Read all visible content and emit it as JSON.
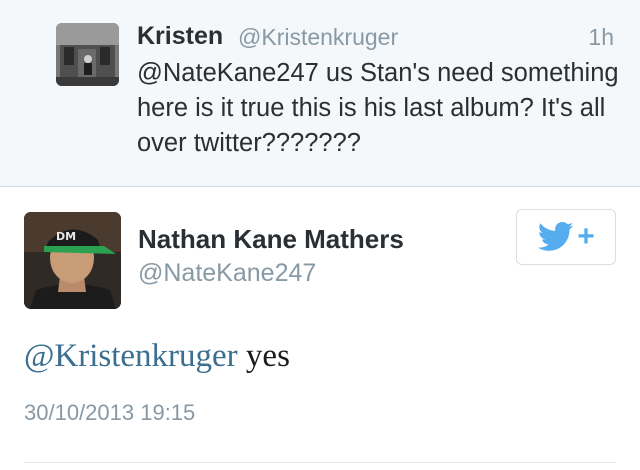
{
  "reply_tweet": {
    "name": "Kristen",
    "handle": "@Kristenkruger",
    "time": "1h",
    "text": "@NateKane247 us Stan's need something here is it true this is his last album? It's all over twitter???????"
  },
  "main_tweet": {
    "name": "Nathan Kane Mathers",
    "handle": "@NateKane247",
    "mention": "@Kristenkruger",
    "text_rest": " yes",
    "date": "30/10/2013 19:15",
    "cap_text": "DM",
    "follow_icon": "twitter-bird-follow-icon"
  },
  "colors": {
    "link": "#3b6e8f",
    "twitter_blue": "#55acee",
    "muted": "#8899a6",
    "reply_background": "#f5f8fa"
  }
}
